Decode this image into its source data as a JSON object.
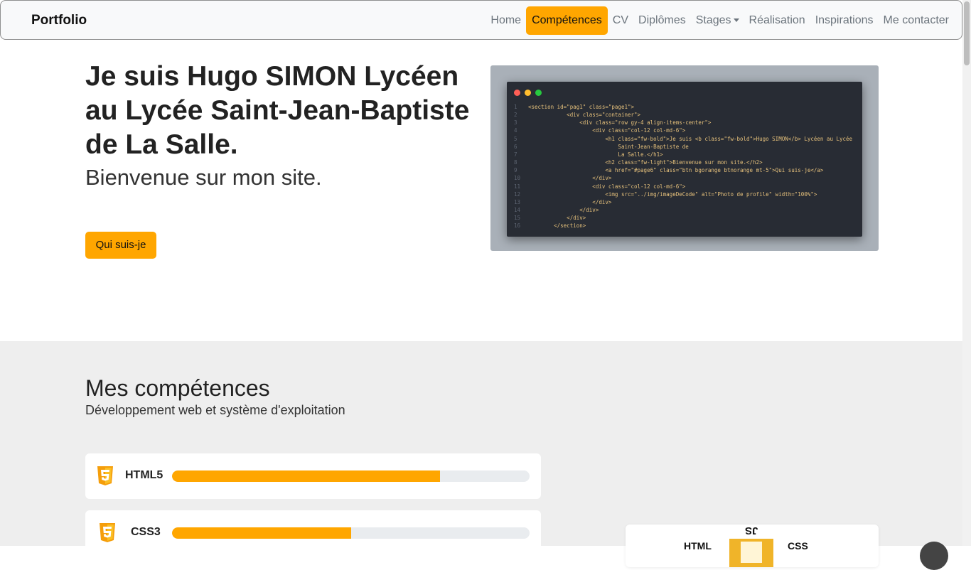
{
  "navbar": {
    "brand": "Portfolio",
    "links": [
      {
        "label": "Home"
      },
      {
        "label": "Compétences",
        "active": true
      },
      {
        "label": "CV"
      },
      {
        "label": "Diplômes"
      },
      {
        "label": "Stages",
        "dropdown": true
      },
      {
        "label": "Réalisation"
      },
      {
        "label": "Inspirations"
      },
      {
        "label": "Me contacter"
      }
    ]
  },
  "hero": {
    "title": "Je suis Hugo SIMON Lycéen au Lycée Saint-Jean-Baptiste de La Salle.",
    "subtitle": "Bienvenue sur mon site.",
    "button": "Qui suis-je"
  },
  "code_image": {
    "lines": [
      {
        "n": "1",
        "text": "<section id=\"pag1\" class=\"page1\">"
      },
      {
        "n": "2",
        "text": "            <div class=\"container\">"
      },
      {
        "n": "3",
        "text": "                <div class=\"row gy-4 align-items-center\">"
      },
      {
        "n": "4",
        "text": "                    <div class=\"col-12 col-md-6\">"
      },
      {
        "n": "5",
        "text": "                        <h1 class=\"fw-bold\">Je suis <b class=\"fw-bold\">Hugo SIMON</b> Lycéen au Lycée"
      },
      {
        "n": "6",
        "text": "                            Saint-Jean-Baptiste de"
      },
      {
        "n": "7",
        "text": "                            La Salle.</h1>"
      },
      {
        "n": "8",
        "text": "                        <h2 class=\"fw-light\">Bienvenue sur mon site.</h2>"
      },
      {
        "n": "9",
        "text": "                        <a href=\"#page6\" class=\"btn bgorange btnorange mt-5\">Qui suis-je</a>"
      },
      {
        "n": "10",
        "text": "                    </div>"
      },
      {
        "n": "11",
        "text": "                    <div class=\"col-12 col-md-6\">"
      },
      {
        "n": "12",
        "text": "                        <img src=\"../img/imageDeCode\" alt=\"Photo de profile\" width=\"100%\">"
      },
      {
        "n": "13",
        "text": "                    </div>"
      },
      {
        "n": "14",
        "text": "                </div>"
      },
      {
        "n": "15",
        "text": "            </div>"
      },
      {
        "n": "16",
        "text": "        </section>"
      }
    ]
  },
  "skills": {
    "title": "Mes compétences",
    "subtitle": "Développement web et système d'exploitation",
    "items": [
      {
        "name": "HTML5",
        "icon": "html5-icon",
        "level": 0.75
      },
      {
        "name": "CSS3",
        "icon": "css3-icon",
        "level": 0.5
      }
    ],
    "side_card": {
      "left_text": "HTML",
      "right_text": "CSS",
      "top_text": "JS"
    }
  },
  "colors": {
    "accent": "#ffa600",
    "section_bg": "#eeeeee",
    "code_bg": "#282c34"
  }
}
